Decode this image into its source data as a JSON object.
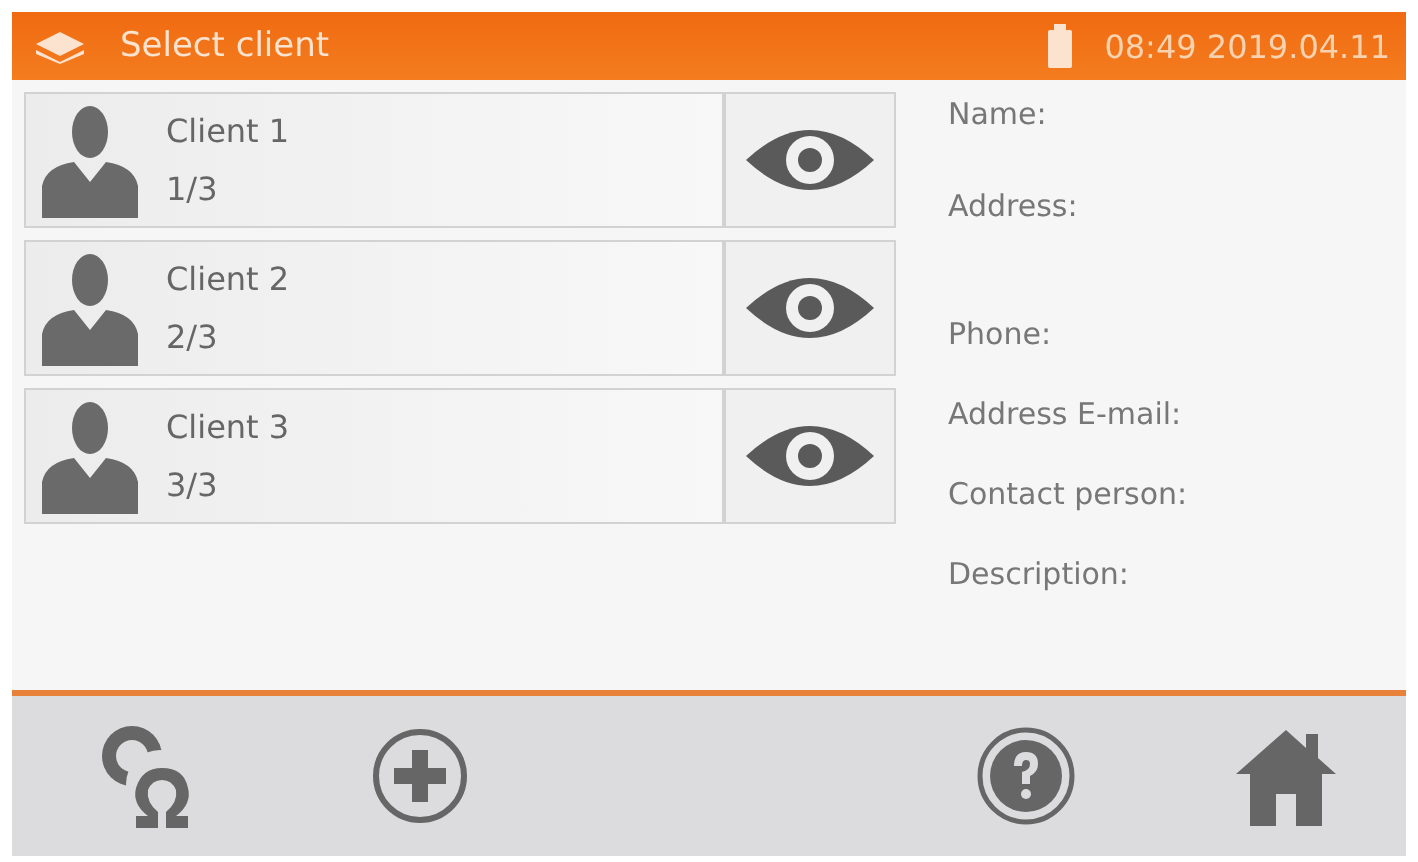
{
  "header": {
    "title": "Select client",
    "time": "08:49 2019.04.11"
  },
  "clients": [
    {
      "name": "Client 1",
      "index": "1/3"
    },
    {
      "name": "Client 2",
      "index": "2/3"
    },
    {
      "name": "Client 3",
      "index": "3/3"
    }
  ],
  "details": [
    "Name:",
    "Address:",
    "Phone:",
    "Address E-mail:",
    "Contact person:",
    "Description:"
  ]
}
